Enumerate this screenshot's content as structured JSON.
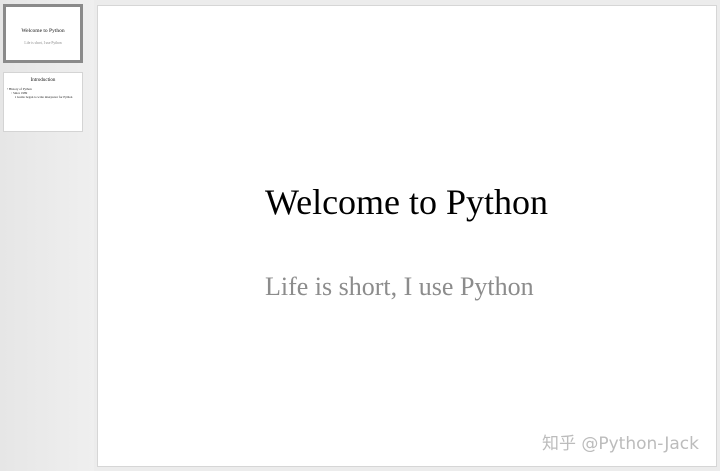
{
  "thumbnails": [
    {
      "title": "Welcome to Python",
      "subtitle": "Life is short, I use Python"
    },
    {
      "title": "Introduction",
      "bullets": [
        "History of Python",
        "Since 1989",
        "Guido began to write interpreter for Python"
      ]
    }
  ],
  "slide": {
    "title": "Welcome to Python",
    "subtitle": "Life is short, I use Python"
  },
  "watermark": "知乎 @Python-Jack"
}
